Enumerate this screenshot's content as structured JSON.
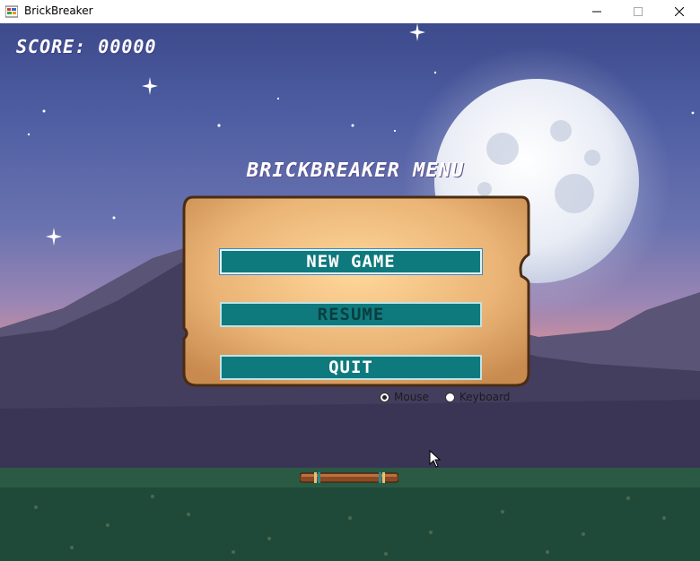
{
  "window": {
    "title": "BrickBreaker",
    "icon": "app-window-icon",
    "controls": [
      "minimize-icon",
      "maximize-icon",
      "close-icon"
    ]
  },
  "hud": {
    "score": "SCORE: 00000"
  },
  "menu": {
    "title": "BRICKBREAKER MENU",
    "buttons": {
      "new_game": "NEW GAME",
      "resume": "RESUME",
      "quit": "QUIT"
    },
    "input_mode": {
      "options": [
        "Mouse",
        "Keyboard"
      ],
      "selected": "Mouse"
    }
  },
  "colors": {
    "button_bg": "#0f7a7e",
    "panel": "#e9b877",
    "sky_top": "#3d4a8c",
    "horizon": "#f0a08c",
    "ground": "#1f4a3a"
  }
}
